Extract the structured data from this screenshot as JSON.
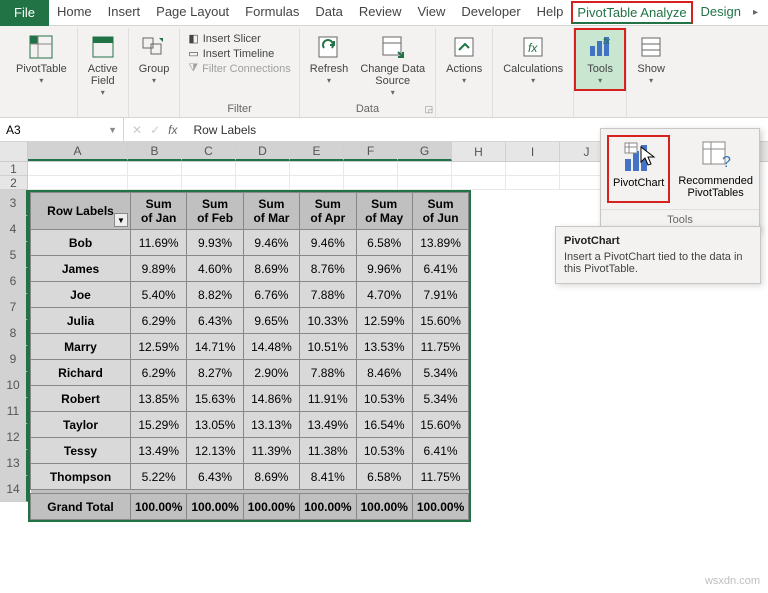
{
  "menubar": {
    "file": "File",
    "items": [
      "Home",
      "Insert",
      "Page Layout",
      "Formulas",
      "Data",
      "Review",
      "View",
      "Developer",
      "Help"
    ],
    "pta": "PivotTable Analyze",
    "design": "Design"
  },
  "ribbon": {
    "pivottable": "PivotTable",
    "activefield": "Active\nField",
    "group": "Group",
    "filter_items": {
      "slicer": "Insert Slicer",
      "timeline": "Insert Timeline",
      "conn": "Filter Connections"
    },
    "filter_label": "Filter",
    "refresh": "Refresh",
    "changedata": "Change Data\nSource",
    "data_label": "Data",
    "actions": "Actions",
    "calculations": "Calculations",
    "tools": "Tools",
    "show": "Show"
  },
  "namebox": {
    "ref": "A3",
    "formula": "Row Labels"
  },
  "columns": [
    "A",
    "B",
    "C",
    "D",
    "E",
    "F",
    "G",
    "H",
    "I",
    "J"
  ],
  "rows": [
    "1",
    "2",
    "3",
    "4",
    "5",
    "6",
    "7",
    "8",
    "9",
    "10",
    "11",
    "12",
    "13",
    "14"
  ],
  "chart_data": {
    "type": "table",
    "title": "Row Labels",
    "headers": [
      "Row Labels",
      "Sum of Jan",
      "Sum of Feb",
      "Sum of Mar",
      "Sum of Apr",
      "Sum of May",
      "Sum of Jun"
    ],
    "rows": [
      {
        "name": "Bob",
        "v": [
          "11.69%",
          "9.93%",
          "9.46%",
          "9.46%",
          "6.58%",
          "13.89%"
        ]
      },
      {
        "name": "James",
        "v": [
          "9.89%",
          "4.60%",
          "8.69%",
          "8.76%",
          "9.96%",
          "6.41%"
        ]
      },
      {
        "name": "Joe",
        "v": [
          "5.40%",
          "8.82%",
          "6.76%",
          "7.88%",
          "4.70%",
          "7.91%"
        ]
      },
      {
        "name": "Julia",
        "v": [
          "6.29%",
          "6.43%",
          "9.65%",
          "10.33%",
          "12.59%",
          "15.60%"
        ]
      },
      {
        "name": "Marry",
        "v": [
          "12.59%",
          "14.71%",
          "14.48%",
          "10.51%",
          "13.53%",
          "11.75%"
        ]
      },
      {
        "name": "Richard",
        "v": [
          "6.29%",
          "8.27%",
          "2.90%",
          "7.88%",
          "8.46%",
          "5.34%"
        ]
      },
      {
        "name": "Robert",
        "v": [
          "13.85%",
          "15.63%",
          "14.86%",
          "11.91%",
          "10.53%",
          "5.34%"
        ]
      },
      {
        "name": "Taylor",
        "v": [
          "15.29%",
          "13.05%",
          "13.13%",
          "13.49%",
          "16.54%",
          "15.60%"
        ]
      },
      {
        "name": "Tessy",
        "v": [
          "13.49%",
          "12.13%",
          "11.39%",
          "11.38%",
          "10.53%",
          "6.41%"
        ]
      },
      {
        "name": "Thompson",
        "v": [
          "5.22%",
          "6.43%",
          "8.69%",
          "8.41%",
          "6.58%",
          "11.75%"
        ]
      }
    ],
    "total": {
      "name": "Grand Total",
      "v": [
        "100.00%",
        "100.00%",
        "100.00%",
        "100.00%",
        "100.00%",
        "100.00%"
      ]
    }
  },
  "popup": {
    "pivotchart": "PivotChart",
    "recommended": "Recommended\nPivotTables",
    "label": "Tools",
    "tip_title": "PivotChart",
    "tip_body": "Insert a PivotChart tied to the data in this PivotTable."
  },
  "watermark": "wsxdn.com"
}
